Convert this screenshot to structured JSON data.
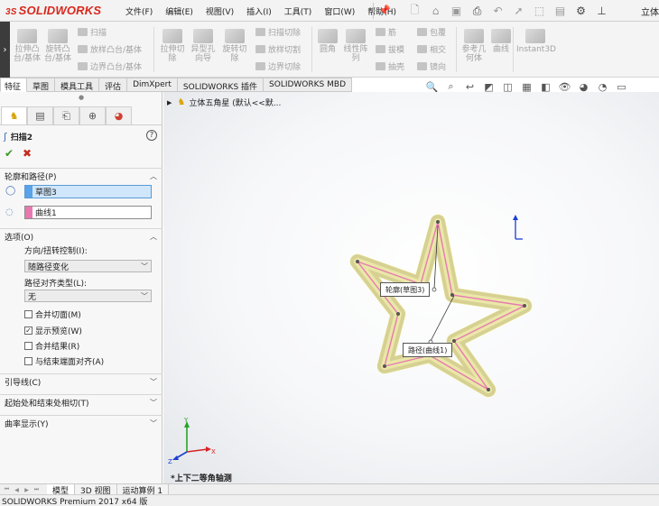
{
  "app": {
    "logo_ds": "3S",
    "logo_text": "SOLIDWORKS",
    "title_tail": "立体",
    "accent": "#d8281c"
  },
  "menu": [
    "文件(F)",
    "编辑(E)",
    "视图(V)",
    "插入(I)",
    "工具(T)",
    "窗口(W)",
    "帮助(H)"
  ],
  "ribbon": {
    "boss_extrude": "拉伸凸\n台/基体",
    "boss_revolve": "旋转凸\n台/基体",
    "sweep": "扫描",
    "loft": "放样凸台/基体",
    "boundary": "边界凸台/基体",
    "cut_extrude": "拉伸切\n除",
    "hole_wizard": "异型孔\n向导",
    "cut_revolve": "旋转切\n除",
    "sweep_cut": "扫描切除",
    "loft_cut": "放样切割",
    "boundary_cut": "边界切除",
    "fillet": "圆角",
    "linear_pattern": "线性阵\n列",
    "rib": "筋",
    "draft": "拔模",
    "shell": "抽壳",
    "wrap": "包覆",
    "intersect": "相交",
    "mirror": "镜向",
    "ref_geometry": "参考几\n何体",
    "curves": "曲线",
    "instant3d": "Instant3D"
  },
  "tabs": [
    "特征",
    "草图",
    "模具工具",
    "评估",
    "DimXpert",
    "SOLIDWORKS 插件",
    "SOLIDWORKS MBD"
  ],
  "property_manager": {
    "title": "扫描2",
    "sections": {
      "profile_path": "轮廓和路径(P)",
      "options": "选项(O)",
      "guide_curves": "引导线(C)",
      "start_end": "起始处和结束处相切(T)",
      "curvature": "曲率显示(Y)"
    },
    "profile_value": "草图3",
    "path_value": "曲线1",
    "profile_color": "#5aa3e8",
    "path_color": "#e879b0",
    "orientation_label": "方向/扭转控制(I):",
    "orientation_value": "随路径变化",
    "alignment_label": "路径对齐类型(L):",
    "alignment_value": "无",
    "checkboxes": [
      {
        "label": "合并切面(M)",
        "checked": false
      },
      {
        "label": "显示预览(W)",
        "checked": true
      },
      {
        "label": "合并结果(R)",
        "checked": false
      },
      {
        "label": "与结束端面对齐(A)",
        "checked": false
      }
    ]
  },
  "graphics": {
    "tree_item": "立体五角星  (默认<<默...",
    "profile_callout": "轮廓(草图3)",
    "path_callout": "路径(曲线1)",
    "view_name": "*上下二等角轴测",
    "preview_color": "#f2ee3a"
  },
  "bottom_tabs": [
    "模型",
    "3D 视图",
    "运动算例 1"
  ],
  "status": "SOLIDWORKS Premium 2017 x64 版"
}
